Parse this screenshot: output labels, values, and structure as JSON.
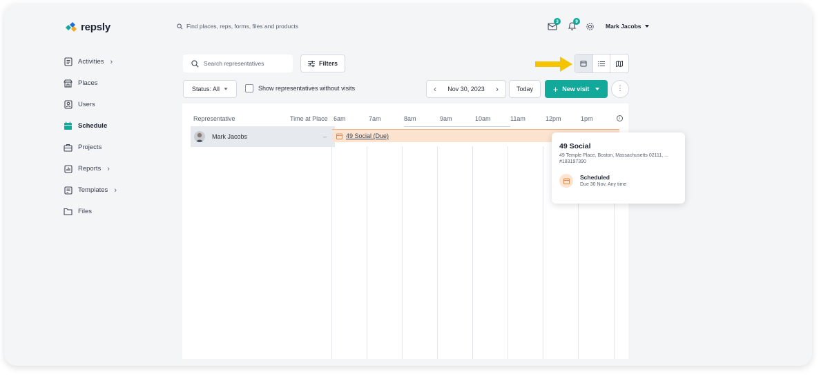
{
  "brand": {
    "name": "repsly",
    "accent": "#12a89a"
  },
  "global_search": {
    "placeholder": "Find places, reps, forms, files and products"
  },
  "topbar": {
    "messages_badge": "3",
    "notifications_badge": "9",
    "user_name": "Mark Jacobs"
  },
  "sidebar": {
    "items": [
      {
        "label": "Activities",
        "icon": "clipboard-list-icon",
        "has_submenu": true
      },
      {
        "label": "Places",
        "icon": "store-icon",
        "has_submenu": false
      },
      {
        "label": "Users",
        "icon": "user-badge-icon",
        "has_submenu": false
      },
      {
        "label": "Schedule",
        "icon": "calendar-icon",
        "has_submenu": false,
        "active": true
      },
      {
        "label": "Projects",
        "icon": "briefcase-icon",
        "has_submenu": false
      },
      {
        "label": "Reports",
        "icon": "bar-chart-icon",
        "has_submenu": true
      },
      {
        "label": "Templates",
        "icon": "template-icon",
        "has_submenu": true
      },
      {
        "label": "Files",
        "icon": "folder-icon",
        "has_submenu": false
      }
    ]
  },
  "toolbar": {
    "search_placeholder": "Search representatives",
    "filters_label": "Filters",
    "status_label": "Status: All",
    "show_without_visits_label": "Show representatives without visits",
    "show_without_visits_checked": false,
    "date_label": "Nov 30, 2023",
    "today_label": "Today",
    "new_visit_label": "New visit",
    "view_modes": [
      "calendar-view-icon",
      "list-view-icon",
      "map-view-icon"
    ],
    "active_view": "calendar"
  },
  "grid": {
    "col_representative": "Representative",
    "col_time_at_place": "Time at Place",
    "hours": [
      "6am",
      "7am",
      "8am",
      "9am",
      "10am",
      "11am",
      "12pm",
      "1pm"
    ],
    "rows": [
      {
        "name": "Mark Jacobs",
        "time_at_place": "–",
        "visit_label": "49 Social (Due)"
      }
    ]
  },
  "popup": {
    "title": "49 Social",
    "address": "49 Temple Place, Boston, Massachusetts 02111, ...",
    "id": "#183197390",
    "status": "Scheduled",
    "due": "Due 30 Nov, Any time"
  },
  "colors": {
    "highlight_arrow": "#f5c400",
    "visit_bar": "#fbe3cf",
    "row_bg": "#e6eaef"
  }
}
